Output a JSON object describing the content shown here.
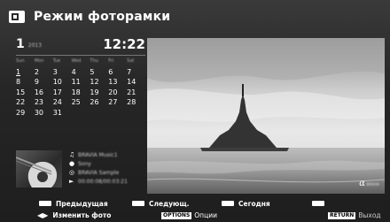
{
  "header": {
    "title": "Режим фоторамки",
    "icon": "photo-frame-icon"
  },
  "calendar": {
    "day": "1",
    "month_label": "2013",
    "time": "12:22",
    "weekdays": [
      "Sun",
      "Mon",
      "Tue",
      "Wed",
      "Thu",
      "Fri",
      "Sat"
    ],
    "weeks": [
      [
        "",
        "",
        "",
        "",
        "",
        "",
        ""
      ],
      [
        "1",
        "2",
        "3",
        "4",
        "5",
        "6",
        "7"
      ],
      [
        "8",
        "9",
        "10",
        "11",
        "12",
        "13",
        "14"
      ],
      [
        "15",
        "16",
        "17",
        "18",
        "19",
        "20",
        "21"
      ],
      [
        "22",
        "23",
        "24",
        "25",
        "26",
        "27",
        "28"
      ],
      [
        "29",
        "30",
        "31",
        "",
        "",
        "",
        ""
      ]
    ]
  },
  "music": {
    "track": "BRAVIA Music1",
    "artist": "Sony",
    "album": "BRAVIA Sample",
    "progress": "00:00:08/00:03:21"
  },
  "photo": {
    "brand_mark": "α",
    "brand_sub": "BRAVIA"
  },
  "buttons": {
    "prev": "Предыдущая",
    "next": "Следующ.",
    "today": "Сегодня",
    "change_photo": "Изменить фото",
    "options_key": "OPTIONS",
    "options": "Опции",
    "return_key": "RETURN",
    "exit": "Выход"
  }
}
